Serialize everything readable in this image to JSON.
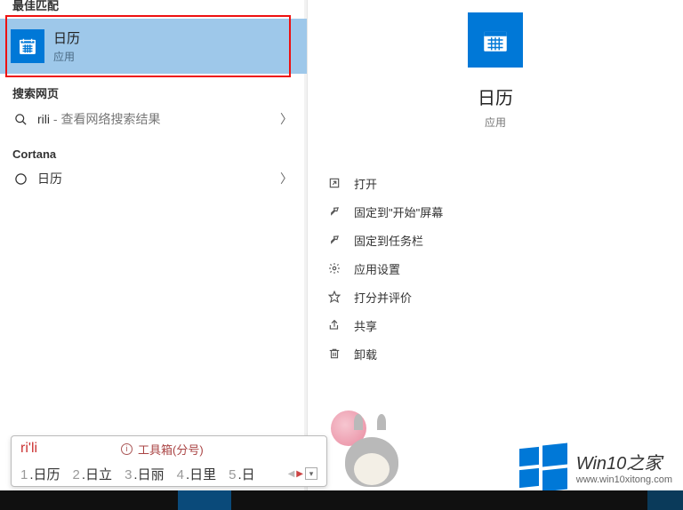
{
  "colors": {
    "accent": "#0078d7",
    "highlight": "#9ec8ea",
    "red_outline": "#e11"
  },
  "left": {
    "best_match_header": "最佳匹配",
    "best_match": {
      "title": "日历",
      "subtitle": "应用",
      "icon": "calendar-icon"
    },
    "web_header": "搜索网页",
    "web_item": {
      "query": "rili",
      "suffix": " - 查看网络搜索结果"
    },
    "cortana_header": "Cortana",
    "cortana_item": {
      "label": "日历"
    }
  },
  "right": {
    "app_title": "日历",
    "app_subtitle": "应用",
    "actions": [
      {
        "icon": "open-icon",
        "label": "打开"
      },
      {
        "icon": "pin-start-icon",
        "label": "固定到\"开始\"屏幕"
      },
      {
        "icon": "pin-taskbar-icon",
        "label": "固定到任务栏"
      },
      {
        "icon": "gear-icon",
        "label": "应用设置"
      },
      {
        "icon": "star-icon",
        "label": "打分并评价"
      },
      {
        "icon": "share-icon",
        "label": "共享"
      },
      {
        "icon": "trash-icon",
        "label": "卸载"
      }
    ]
  },
  "ime": {
    "input": "ri'li",
    "toolbox_label": "工具箱(分号)",
    "candidates": [
      {
        "n": "1",
        "t": "日历"
      },
      {
        "n": "2",
        "t": "日立"
      },
      {
        "n": "3",
        "t": "日丽"
      },
      {
        "n": "4",
        "t": "日里"
      },
      {
        "n": "5",
        "t": "日"
      }
    ]
  },
  "watermark": {
    "title": "Win10之家",
    "url": "www.win10xitong.com"
  }
}
